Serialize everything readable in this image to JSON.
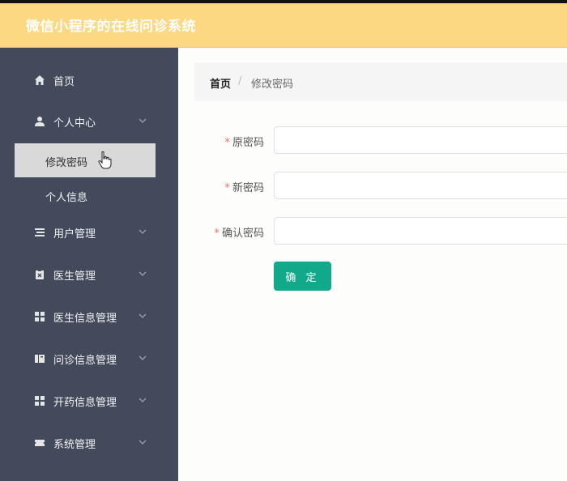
{
  "app": {
    "title": "微信小程序的在线问诊系统"
  },
  "sidebar": {
    "items": [
      {
        "label": "首页"
      },
      {
        "label": "个人中心",
        "children": [
          {
            "label": "修改密码"
          },
          {
            "label": "个人信息"
          }
        ]
      },
      {
        "label": "用户管理"
      },
      {
        "label": "医生管理"
      },
      {
        "label": "医生信息管理"
      },
      {
        "label": "问诊信息管理"
      },
      {
        "label": "开药信息管理"
      },
      {
        "label": "系统管理"
      }
    ],
    "active_item": "修改密码"
  },
  "breadcrumb": {
    "home": "首页",
    "separator": "/",
    "current": "修改密码"
  },
  "form": {
    "required_mark": "*",
    "fields": [
      {
        "label": "原密码",
        "value": ""
      },
      {
        "label": "新密码",
        "value": ""
      },
      {
        "label": "确认密码",
        "value": ""
      }
    ],
    "submit_label": "确 定"
  },
  "colors": {
    "header": "#fdd882",
    "sidebar": "#434a5b",
    "button": "#11a98a",
    "active_item": "#d9d9d9"
  }
}
